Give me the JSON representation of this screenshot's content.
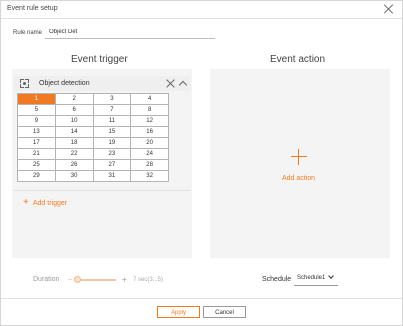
{
  "dialog": {
    "title": "Event rule setup"
  },
  "rule": {
    "label": "Rule name",
    "value": "Object Det"
  },
  "trigger": {
    "heading": "Event trigger",
    "name": "Object detection",
    "selected": "1",
    "cells": [
      [
        "1",
        "2",
        "3",
        "4"
      ],
      [
        "5",
        "6",
        "7",
        "8"
      ],
      [
        "9",
        "10",
        "11",
        "12"
      ],
      [
        "13",
        "14",
        "15",
        "16"
      ],
      [
        "17",
        "18",
        "19",
        "20"
      ],
      [
        "21",
        "22",
        "23",
        "24"
      ],
      [
        "25",
        "26",
        "27",
        "28"
      ],
      [
        "29",
        "30",
        "31",
        "32"
      ]
    ],
    "add_label": "Add trigger"
  },
  "action": {
    "heading": "Event action",
    "add_label": "Add action"
  },
  "duration": {
    "label": "Duration",
    "value": "7 sec(3...5)",
    "level": 0.0
  },
  "schedule": {
    "label": "Schedule",
    "value": "Schedule1"
  },
  "buttons": {
    "apply": "Apply",
    "cancel": "Cancel"
  },
  "colors": {
    "accent": "#f07a24",
    "panel": "#f4f4f4"
  }
}
